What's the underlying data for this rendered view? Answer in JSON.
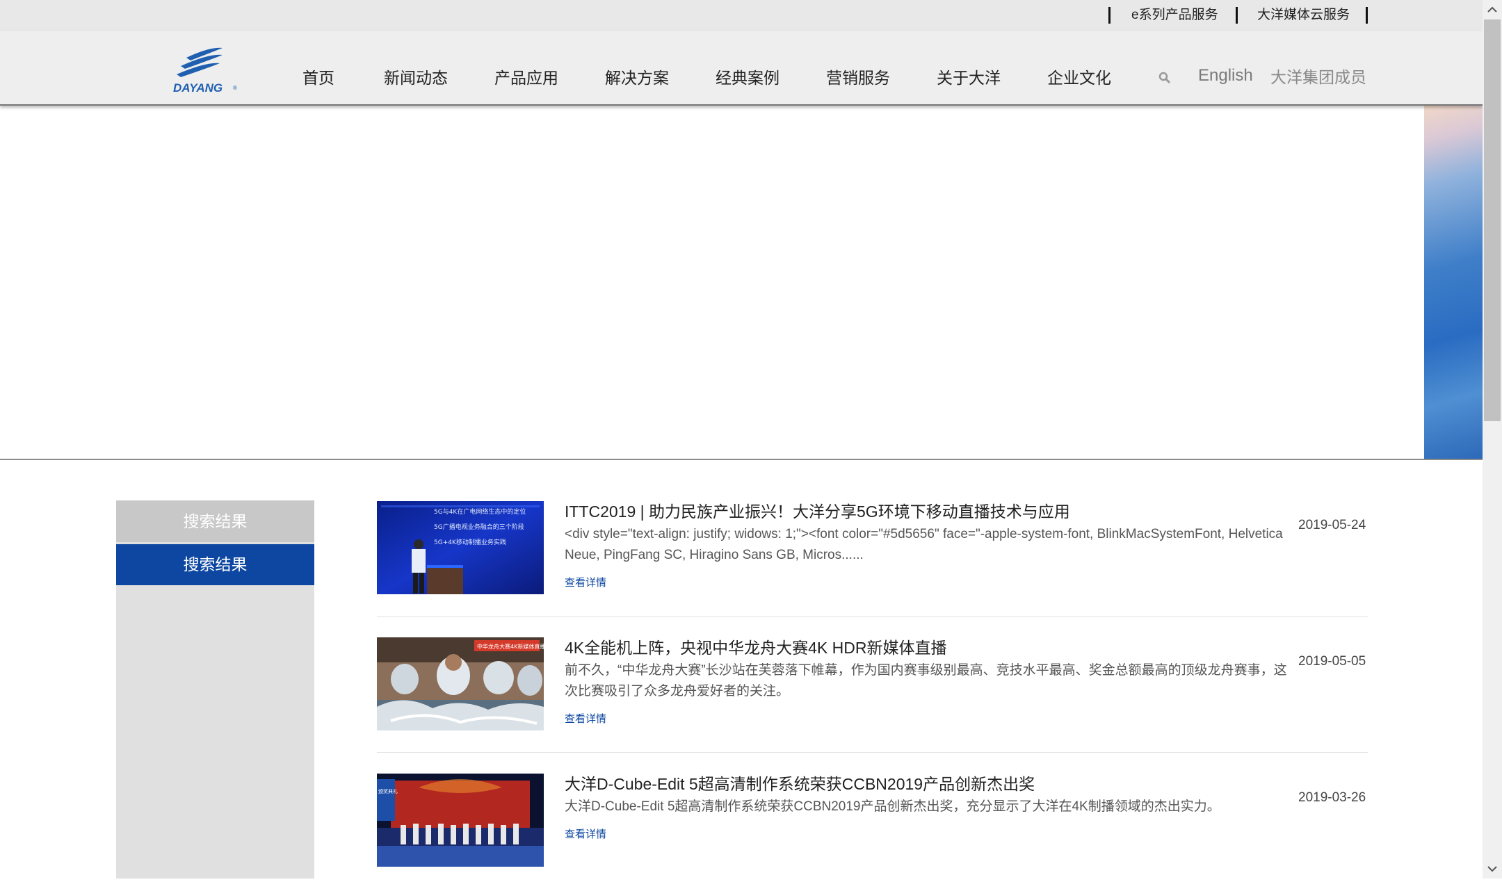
{
  "topbar": {
    "links": [
      "e系列产品服务",
      "大洋媒体云服务"
    ]
  },
  "nav": {
    "logo_text": "DAYANG",
    "items": [
      "首页",
      "新闻动态",
      "产品应用",
      "解决方案",
      "经典案例",
      "营销服务",
      "关于大洋",
      "企业文化"
    ],
    "search_icon": "search-icon",
    "english": "English",
    "member": "大洋集团成员"
  },
  "sidebar": {
    "header": "搜索结果",
    "active": "搜索结果"
  },
  "results": [
    {
      "title": "ITTC2019 | 助力民族产业振兴！大洋分享5G环境下移动直播技术与应用",
      "desc": "<div style=\"text-align: justify; widows: 1;\"><font color=\"#5d5656\" face=\"-apple-system-font, BlinkMacSystemFont, Helvetica Neue, PingFang SC, Hiragino Sans GB, Micros......",
      "date": "2019-05-24",
      "more": "查看详情",
      "thumb_text": [
        "5G与4K在广电网络生态中的定位",
        "5G广播电视业务融合的三个阶段",
        "5G+4K移动制播业务实践"
      ]
    },
    {
      "title": "4K全能机上阵，央视中华龙舟大赛4K HDR新媒体直播",
      "desc": "前不久，“中华龙舟大赛”长沙站在芙蓉落下帷幕，作为国内赛事级别最高、竞技水平最高、奖金总额最高的顶级龙舟赛事，这次比赛吸引了众多龙舟爱好者的关注。",
      "date": "2019-05-05",
      "more": "查看详情",
      "thumb_text": [
        "中华龙舟大赛4K新媒体直播"
      ]
    },
    {
      "title": "大洋D-Cube-Edit 5超高清制作系统荣获CCBN2019产品创新杰出奖",
      "desc": "大洋D-Cube-Edit 5超高清制作系统荣获CCBN2019产品创新杰出奖，充分显示了大洋在4K制播领域的杰出实力。",
      "date": "2019-03-26",
      "more": "查看详情",
      "thumb_text": [
        "颁奖典礼"
      ]
    }
  ],
  "colors": {
    "primary": "#0d47a1",
    "nav_bg": "#eeeeee",
    "topbar_bg": "#e8e8e8",
    "sidebar_bg": "#e0e0e0"
  }
}
